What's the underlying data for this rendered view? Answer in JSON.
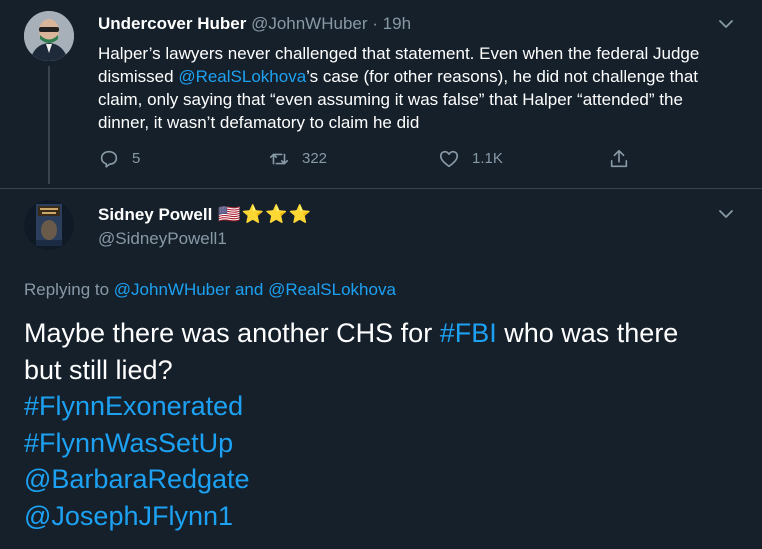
{
  "parent_tweet": {
    "author_name": "Undercover Huber",
    "author_handle": "@JohnWHuber",
    "dot": "·",
    "time": "19h",
    "body_pre": "Halper’s lawyers never challenged that statement. Even when the federal Judge dismissed ",
    "body_mention": "@RealSLokhova",
    "body_post": "’s case (for other reasons), he did not challenge that claim, only saying that “even assuming it was false” that Halper “attended” the dinner, it wasn’t defamatory to claim he did",
    "actions": {
      "reply_count": "5",
      "retweet_count": "322",
      "like_count": "1.1K"
    }
  },
  "main_tweet": {
    "author_name": "Sidney Powell",
    "author_emoji": "🇺🇸⭐⭐⭐",
    "author_handle": "@SidneyPowell1",
    "replying_prefix": "Replying to ",
    "replying_user1": "@JohnWHuber",
    "replying_and": " and ",
    "replying_user2": "@RealSLokhova",
    "body_line1_pre": "Maybe there was another CHS for ",
    "body_hashtag_fbi": "#FBI",
    "body_line1_post": " who was there",
    "body_line2": "but still lied?",
    "tag1": "#FlynnExonerated",
    "tag2": "#FlynnWasSetUp",
    "tag3": "@BarbaraRedgate",
    "tag4": "@JosephJFlynn1"
  },
  "colors": {
    "background": "#15202b",
    "link": "#1da1f2",
    "muted": "#8899a6",
    "divider": "#38444d"
  },
  "icons": [
    "chevron-down-icon",
    "reply-icon",
    "retweet-icon",
    "like-icon",
    "share-icon"
  ]
}
